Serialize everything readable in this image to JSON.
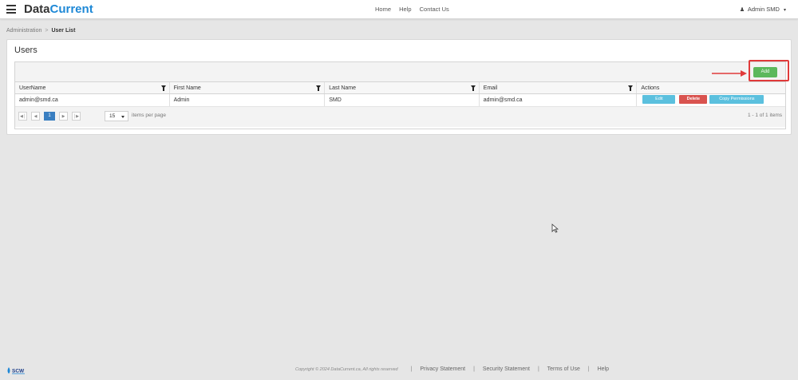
{
  "brand": {
    "part1": "Data",
    "part2": "Current"
  },
  "topnav": {
    "home": "Home",
    "help": "Help",
    "contact": "Contact Us"
  },
  "user": {
    "name": "Admin SMD"
  },
  "breadcrumb": {
    "parent": "Administration",
    "separator": ">",
    "current": "User List"
  },
  "card": {
    "title": "Users"
  },
  "toolbar": {
    "add_label": "Add"
  },
  "grid": {
    "columns": [
      "UserName",
      "First Name",
      "Last Name",
      "Email",
      "Actions"
    ],
    "rows": [
      {
        "username": "admin@smd.ca",
        "first_name": "Admin",
        "last_name": "SMD",
        "email": "admin@smd.ca"
      }
    ],
    "actions": {
      "edit": "Edit",
      "delete": "Delete",
      "copy": "Copy Permissions"
    }
  },
  "pager": {
    "first_icon": "first-page-icon",
    "prev_icon": "prev-page-icon",
    "current_page": "1",
    "next_icon": "next-page-icon",
    "last_icon": "last-page-icon",
    "page_size": "15",
    "items_per_page_label": "items per page",
    "range_text": "1 - 1 of 1 items"
  },
  "footer": {
    "logo_text": "SCW",
    "copyright": "Copyright © 2024 DataCurrent.ca, All rights reserved",
    "links": [
      "Privacy Statement",
      "Security Statement",
      "Terms of Use",
      "Help"
    ]
  },
  "colors": {
    "brand_accent": "#1e88d6",
    "add_button": "#5cb85c",
    "edit_button": "#5bc0de",
    "delete_button": "#d9534f",
    "pager_active": "#3a7fc1",
    "annotation": "#e03a3a"
  }
}
